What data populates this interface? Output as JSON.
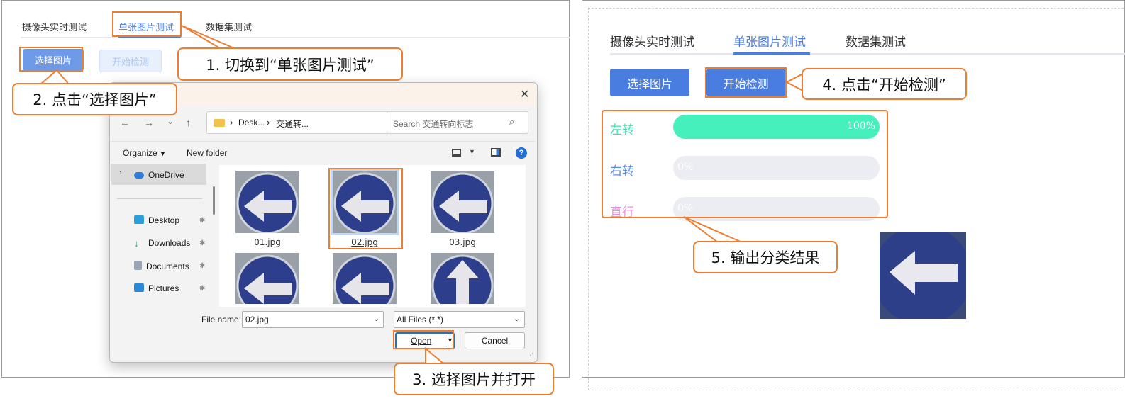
{
  "left_panel": {
    "tabs": [
      "摄像头实时测试",
      "单张图片测试",
      "数据集测试"
    ],
    "select_button": "选择图片",
    "start_button": "开始检测"
  },
  "dialog": {
    "close_glyph": "✕",
    "address": {
      "part1": "Desk...",
      "separator": "›",
      "part2": "交通转..."
    },
    "search_placeholder": "Search 交通转向标志",
    "organize": "Organize",
    "new_folder": "New folder",
    "nav": {
      "onedrive": "OneDrive",
      "desktop": "Desktop",
      "downloads": "Downloads",
      "documents": "Documents",
      "pictures": "Pictures"
    },
    "files": [
      {
        "name": "01.jpg",
        "arrow": "left"
      },
      {
        "name": "02.jpg",
        "arrow": "left",
        "selected": true
      },
      {
        "name": "03.jpg",
        "arrow": "left"
      },
      {
        "name": "",
        "arrow": "left"
      },
      {
        "name": "",
        "arrow": "left"
      },
      {
        "name": "",
        "arrow": "up"
      }
    ],
    "filename_label": "File name:",
    "filename_value": "02.jpg",
    "filetype_value": "All Files (*.*)",
    "open_button": "Open",
    "cancel_button": "Cancel"
  },
  "right_panel": {
    "tabs": [
      "摄像头实时测试",
      "单张图片测试",
      "数据集测试"
    ],
    "select_button": "选择图片",
    "start_button": "开始检测",
    "results": [
      {
        "label": "左转",
        "percent": 100,
        "text": "100%",
        "label_color": "#3fe0b0",
        "fill_color": "#46f0bd"
      },
      {
        "label": "右转",
        "percent": 0,
        "text": "0%",
        "label_color": "#5b8ae6",
        "fill_color": "#5b8ae6"
      },
      {
        "label": "直行",
        "percent": 0,
        "text": "0%",
        "label_color": "#f08be4",
        "fill_color": "#f08be4"
      }
    ]
  },
  "callouts": {
    "step1": "1. 切换到“单张图片测试”",
    "step2": "2. 点击“选择图片”",
    "step3": "3. 选择图片并打开",
    "step4": "4. 点击“开始检测”",
    "step5": "5. 输出分类结果"
  },
  "colors": {
    "accent": "#ed7d31",
    "primary": "#4a7de0",
    "disabled": "#a8c4f0"
  }
}
